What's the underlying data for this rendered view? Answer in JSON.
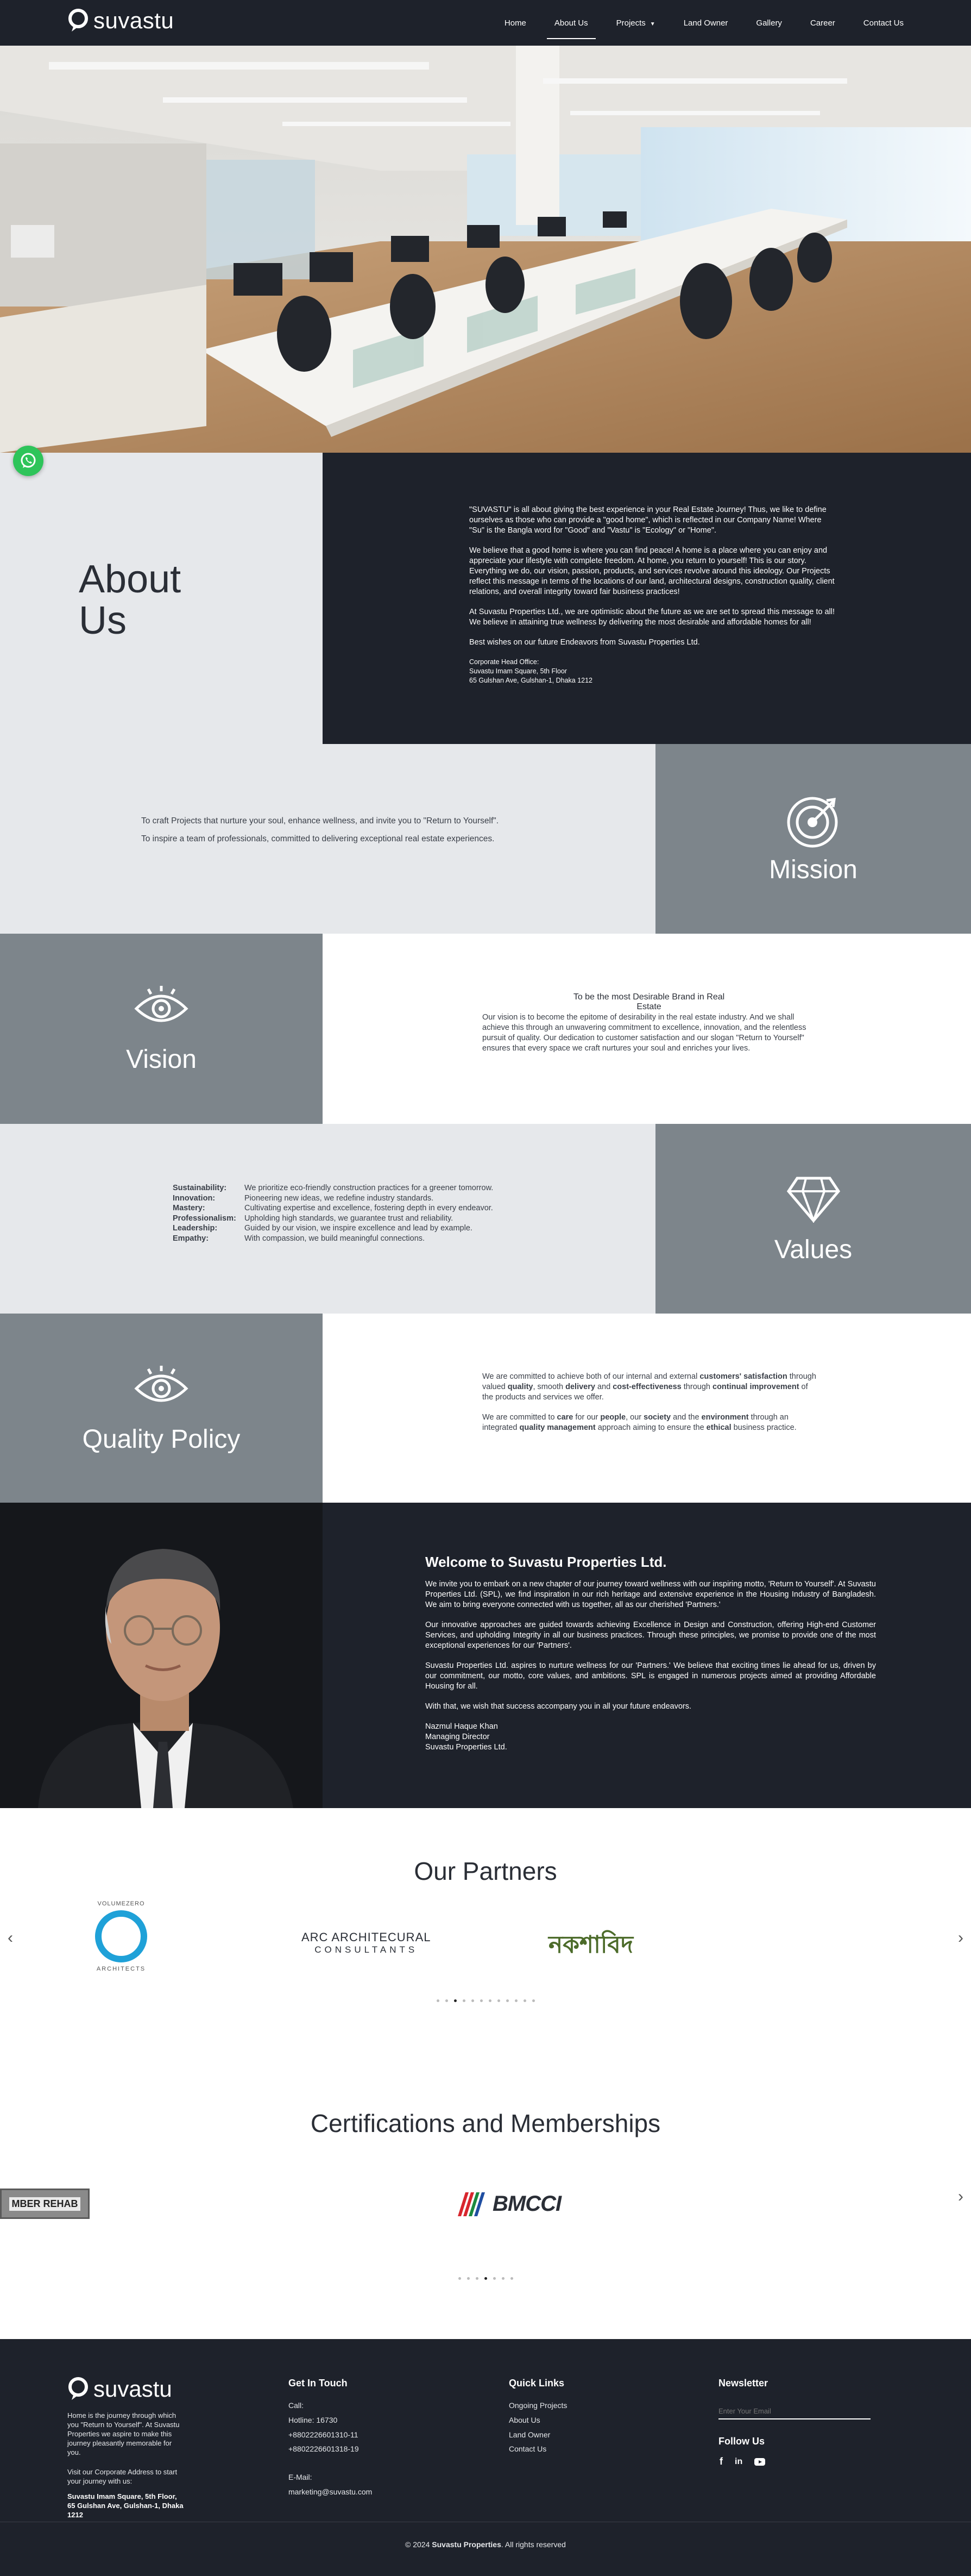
{
  "brand": {
    "name": "suvastu"
  },
  "nav": {
    "items": [
      {
        "label": "Home"
      },
      {
        "label": "About Us"
      },
      {
        "label": "Projects"
      },
      {
        "label": "Land Owner"
      },
      {
        "label": "Gallery"
      },
      {
        "label": "Career"
      },
      {
        "label": "Contact Us"
      }
    ],
    "active": "About Us"
  },
  "about": {
    "title_line1": "About",
    "title_line2": "Us",
    "p1": "\"SUVASTU\" is all about giving the best experience in your Real Estate Journey! Thus, we like to define ourselves as those who can provide a \"good home\", which is reflected in our Company Name! Where \"Su\" is the Bangla word for \"Good\" and \"Vastu\" is \"Ecology\" or \"Home\".",
    "p2": "We believe that a good home is where you can find peace! A home is a place where you can enjoy and appreciate your lifestyle with complete freedom. At home, you return to yourself! This is our story. Everything we do, our vision, passion, products, and services revolve around this ideology. Our Projects reflect this message in terms of the locations of our land, architectural designs, construction quality, client relations, and overall integrity toward fair business practices!",
    "p3": "At Suvastu Properties Ltd., we are optimistic about the future as we are set to spread this message to all! We believe in attaining true wellness by delivering the most desirable and affordable homes for all!",
    "p4": "Best wishes on our future Endeavors from Suvastu Properties Ltd.",
    "office_label": "Corporate Head Office:",
    "office_line1": "Suvastu Imam Square, 5th Floor",
    "office_line2": "65 Gulshan Ave, Gulshan-1, Dhaka 1212"
  },
  "mission": {
    "title": "Mission",
    "line1": "To craft Projects that nurture your soul, enhance wellness, and invite you to \"Return to Yourself\".",
    "line2": "To inspire a team of professionals, committed to delivering exceptional real estate experiences."
  },
  "vision": {
    "title": "Vision",
    "heading": "To be the most Desirable Brand in Real Estate",
    "text": "Our vision is to become the epitome of desirability in the real estate industry. And we shall achieve this through an unwavering commitment to excellence, innovation, and the relentless pursuit of quality. Our dedication to customer satisfaction and our slogan \"Return to Yourself\" ensures that every space we craft nurtures your soul and enriches your lives."
  },
  "values": {
    "title": "Values",
    "items": [
      {
        "name": "Sustainability:",
        "desc": "We prioritize eco-friendly construction practices for a greener tomorrow."
      },
      {
        "name": "Innovation:",
        "desc": "Pioneering new ideas, we redefine industry standards."
      },
      {
        "name": "Mastery:",
        "desc": "Cultivating expertise and excellence, fostering depth in every endeavor."
      },
      {
        "name": "Professionalism:",
        "desc": "Upholding high standards, we guarantee trust and reliability."
      },
      {
        "name": "Leadership:",
        "desc": "Guided by our vision, we inspire excellence and lead by example."
      },
      {
        "name": "Empathy:",
        "desc": "With compassion, we build meaningful connections."
      }
    ]
  },
  "quality": {
    "title": "Quality Policy",
    "p1_a": "We are committed to achieve both of our internal and external ",
    "p1_b": "customers' satisfaction",
    "p1_c": " through valued ",
    "p1_d": "quality",
    "p1_e": ", smooth ",
    "p1_f": "delivery",
    "p1_g": " and ",
    "p1_h": "cost-effectiveness",
    "p1_i": " through ",
    "p1_j": "continual improvement",
    "p1_k": " of the products and services we offer.",
    "p2_a": "We are committed to ",
    "p2_b": "care",
    "p2_c": " for our ",
    "p2_d": "people",
    "p2_e": ", our ",
    "p2_f": "society",
    "p2_g": " and the ",
    "p2_h": "environment",
    "p2_i": " through an integrated ",
    "p2_j": "quality management",
    "p2_k": " approach aiming to ensure the ",
    "p2_l": "ethical",
    "p2_m": " business practice."
  },
  "welcome": {
    "title": "Welcome to Suvastu Properties Ltd.",
    "p1": "We invite you to embark on a new chapter of our journey toward wellness with our inspiring motto, 'Return to Yourself'. At Suvastu Properties Ltd. (SPL), we find inspiration in our rich heritage and extensive experience in the Housing Industry of Bangladesh. We aim to bring everyone connected with us together, all as our cherished 'Partners.'",
    "p2": "Our innovative approaches are guided towards achieving Excellence in Design and Construction, offering High-end Customer Services, and upholding Integrity in all our business practices. Through these principles, we promise to provide one of the most exceptional experiences for our 'Partners'.",
    "p3": "Suvastu Properties Ltd. aspires to nurture wellness for our 'Partners.' We believe that exciting times lie ahead for us, driven by our commitment, our motto, core values, and ambitions. SPL is engaged in numerous projects aimed at providing Affordable Housing for all.",
    "p4": "With that, we wish that success accompany you in all your future endeavors.",
    "sig1": "Nazmul Haque Khan",
    "sig2": "Managing Director",
    "sig3": "Suvastu Properties Ltd."
  },
  "partners": {
    "title": "Our Partners",
    "logos": [
      {
        "top": "VOLUMEZERO",
        "bottom": "ARCHITECTS"
      },
      {
        "line1": "ARC ARCHITECURAL",
        "line2": "CONSULTANTS"
      },
      {
        "text": "নকশাবিদ"
      }
    ],
    "dots_total": 12,
    "dot_active": 2
  },
  "certs": {
    "title": "Certifications and Memberships",
    "logos": [
      {
        "text": "MBER REHAB"
      },
      {
        "text": "BMCCI"
      }
    ],
    "dots_total": 7,
    "dot_active": 3
  },
  "footer": {
    "tagline": "Home is the journey through which you \"Return to Yourself\". At Suvastu Properties we aspire to make this journey pleasantly memorable for you.",
    "visit": "Visit our Corporate Address to start your journey with us:",
    "address": "Suvastu Imam Square, 5th Floor, 65 Gulshan Ave, Gulshan-1, Dhaka 1212",
    "contact_title": "Get In Touch",
    "call_label": "Call:",
    "hotline": "Hotline: 16730",
    "phone1": "+8802226601310-11",
    "phone2": "+8802226601318-19",
    "email_label": "E-Mail:",
    "email": "marketing@suvastu.com",
    "links_title": "Quick Links",
    "links": [
      "Ongoing Projects",
      "About Us",
      "Land Owner",
      "Contact Us"
    ],
    "newsletter_title": "Newsletter",
    "newsletter_placeholder": "Enter Your Email",
    "follow_title": "Follow Us",
    "copyright_a": "© 2024 ",
    "copyright_b": "Suvastu Properties",
    "copyright_c": ". All rights reserved"
  },
  "icons": [
    "whatsapp-icon",
    "target-icon",
    "eye-icon",
    "diamond-icon",
    "facebook-icon",
    "linkedin-icon",
    "youtube-icon"
  ]
}
